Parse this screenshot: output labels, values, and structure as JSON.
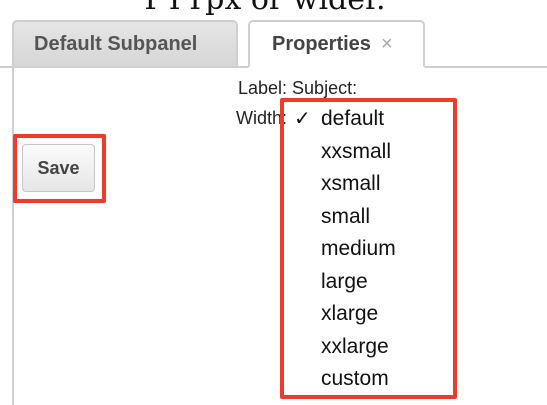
{
  "caption": {
    "text": "PTTpx or wider."
  },
  "tabs": [
    {
      "label": "Default Subpanel",
      "active": false
    },
    {
      "label": "Properties",
      "active": true,
      "close_glyph": "×"
    }
  ],
  "form": {
    "label_text": "Label: Subject:",
    "width_text": "Width:",
    "save_label": "Save"
  },
  "width_dropdown": {
    "selected": "default",
    "check_glyph": "✓",
    "options": [
      "default",
      "xxsmall",
      "xsmall",
      "small",
      "medium",
      "large",
      "xlarge",
      "xxlarge",
      "custom"
    ]
  },
  "colors": {
    "highlight": "#ef3b2c",
    "tab_border": "#cfcfcf"
  },
  "icons": {
    "close": "close-icon",
    "check": "check-icon"
  }
}
